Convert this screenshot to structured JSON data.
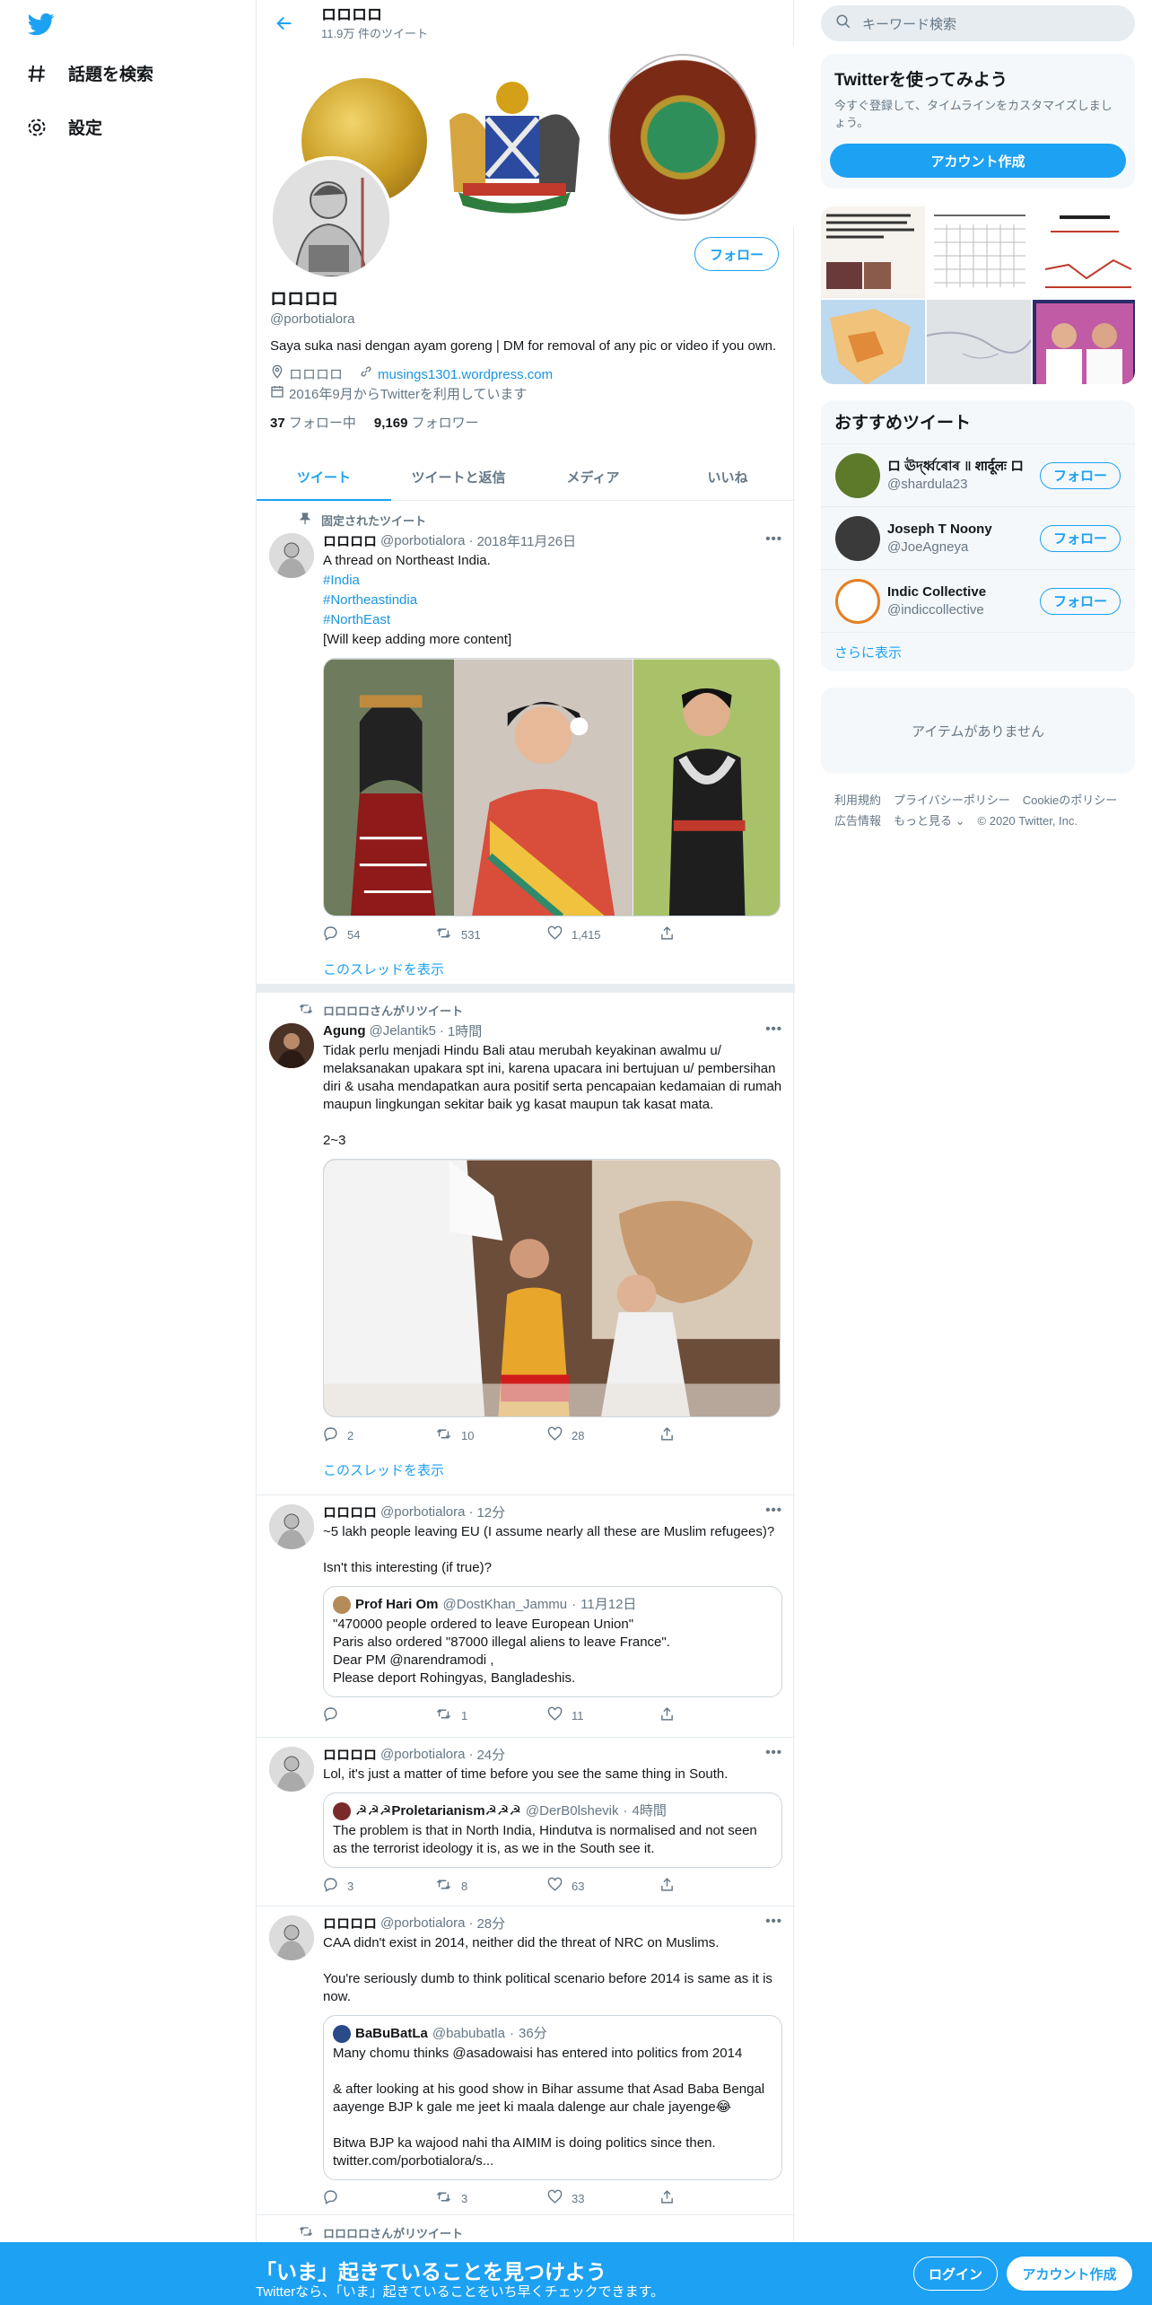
{
  "nav": {
    "explore": "話題を検索",
    "settings": "設定"
  },
  "header": {
    "name": "ロロロロ",
    "tweet_count": "11.9万 件のツイート"
  },
  "profile": {
    "name": "ロロロロ",
    "handle": "@porbotialora",
    "bio": "Saya suka nasi dengan ayam goreng | DM for removal of any pic or video if you own.",
    "location": "ロロロロ",
    "website": "musings1301.wordpress.com",
    "joined": "2016年9月からTwitterを利用しています",
    "following_count": "37",
    "following_label": "フォロー中",
    "followers_count": "9,169",
    "followers_label": "フォロワー",
    "follow_button": "フォロー"
  },
  "tabs": [
    "ツイート",
    "ツイートと返信",
    "メディア",
    "いいね"
  ],
  "tweets": [
    {
      "context": "固定されたツイート",
      "name": "ロロロロ",
      "handle": "@porbotialora",
      "time": "2018年11月26日",
      "text": "A thread on Northeast India.",
      "hashtags": [
        "#India",
        "#Northeastindia",
        "#NorthEast"
      ],
      "text2": "[Will keep adding more content]",
      "replies": "54",
      "retweets": "531",
      "likes": "1,415",
      "show_thread": "このスレッドを表示"
    },
    {
      "context": "ロロロロさんがリツイート",
      "name": "Agung",
      "handle": "@Jelantik5",
      "time": "1時間",
      "text": "Tidak perlu menjadi Hindu Bali atau merubah keyakinan awalmu u/ melaksanakan upakara spt ini, karena upacara ini bertujuan u/ pembersihan diri & usaha mendapatkan aura positif serta pencapaian kedamaian di rumah maupun lingkungan sekitar baik yg kasat maupun tak kasat mata.\n\n2~3",
      "replies": "2",
      "retweets": "10",
      "likes": "28",
      "show_thread": "このスレッドを表示"
    },
    {
      "name": "ロロロロ",
      "handle": "@porbotialora",
      "time": "12分",
      "text": "~5 lakh people leaving EU (I assume nearly all these are Muslim refugees)?\n\nIsn't this interesting (if true)?",
      "quote_name": "Prof Hari Om",
      "quote_handle": "@DostKhan_Jammu",
      "quote_time": "11月12日",
      "quote_text": "\"470000 people ordered to leave European Union\"\nParis also ordered \"87000 illegal aliens to leave France\".\nDear PM @narendramodi ,\nPlease deport Rohingyas, Bangladeshis.",
      "replies": "",
      "retweets": "1",
      "likes": "11"
    },
    {
      "name": "ロロロロ",
      "handle": "@porbotialora",
      "time": "24分",
      "text": "Lol, it's just a matter of time before you see the same thing in South.",
      "quote_name": "☭☭☭Proletarianism☭☭☭",
      "quote_handle": "@DerB0lshevik",
      "quote_time": "4時間",
      "quote_text": "The problem is that in North India, Hindutva is normalised and not seen as the terrorist ideology it is, as we in the South see it.",
      "replies": "3",
      "retweets": "8",
      "likes": "63"
    },
    {
      "name": "ロロロロ",
      "handle": "@porbotialora",
      "time": "28分",
      "text": "CAA didn't exist in 2014, neither did the threat of NRC on Muslims.\n\nYou're seriously dumb to think political scenario before 2014 is same as it is now.",
      "quote_name": "BaBuBatLa",
      "quote_handle": "@babubatla",
      "quote_time": "36分",
      "quote_text": "Many chomu thinks @asadowaisi has entered into politics from 2014\n\n& after looking at his good show in Bihar assume that Asad Baba Bengal aayenge BJP k gale me jeet ki maala dalenge aur chale jayenge😂\n\nBitwa BJP ka wajood nahi tha AIMIM is doing politics since then.\ntwitter.com/porbotialora/s...",
      "replies": "",
      "retweets": "3",
      "likes": "33"
    },
    {
      "context": "ロロロロさんがリツイート"
    }
  ],
  "right": {
    "search_placeholder": "キーワード検索",
    "signup_title": "Twitterを使ってみよう",
    "signup_text": "今すぐ登録して、タイムラインをカスタマイズしましょう。",
    "signup_button": "アカウント作成",
    "who_title": "おすすめツイート",
    "who": [
      {
        "name": "ロ ঊৰ্দ্ধ্বৰোৰ ॥ शार्दूलः ロ",
        "handle": "@shardula23",
        "button": "フォロー"
      },
      {
        "name": "Joseph T Noony",
        "handle": "@JoeAgneya",
        "button": "フォロー"
      },
      {
        "name": "Indic Collective",
        "handle": "@indiccollective",
        "button": "フォロー"
      }
    ],
    "show_more": "さらに表示",
    "empty": "アイテムがありません",
    "footer": [
      "利用規約",
      "プライバシーポリシー",
      "Cookieのポリシー",
      "広告情報",
      "もっと見る ⌄",
      "© 2020 Twitter, Inc."
    ]
  },
  "bottom": {
    "title": "「いま」起きていることを見つけよう",
    "subtitle": "Twitterなら、「いま」起きていることをいち早くチェックできます。",
    "login": "ログイン",
    "signup": "アカウント作成"
  },
  "colors": {
    "accent": "#1da1f2",
    "border": "#e6ecf0",
    "muted": "#657786"
  }
}
